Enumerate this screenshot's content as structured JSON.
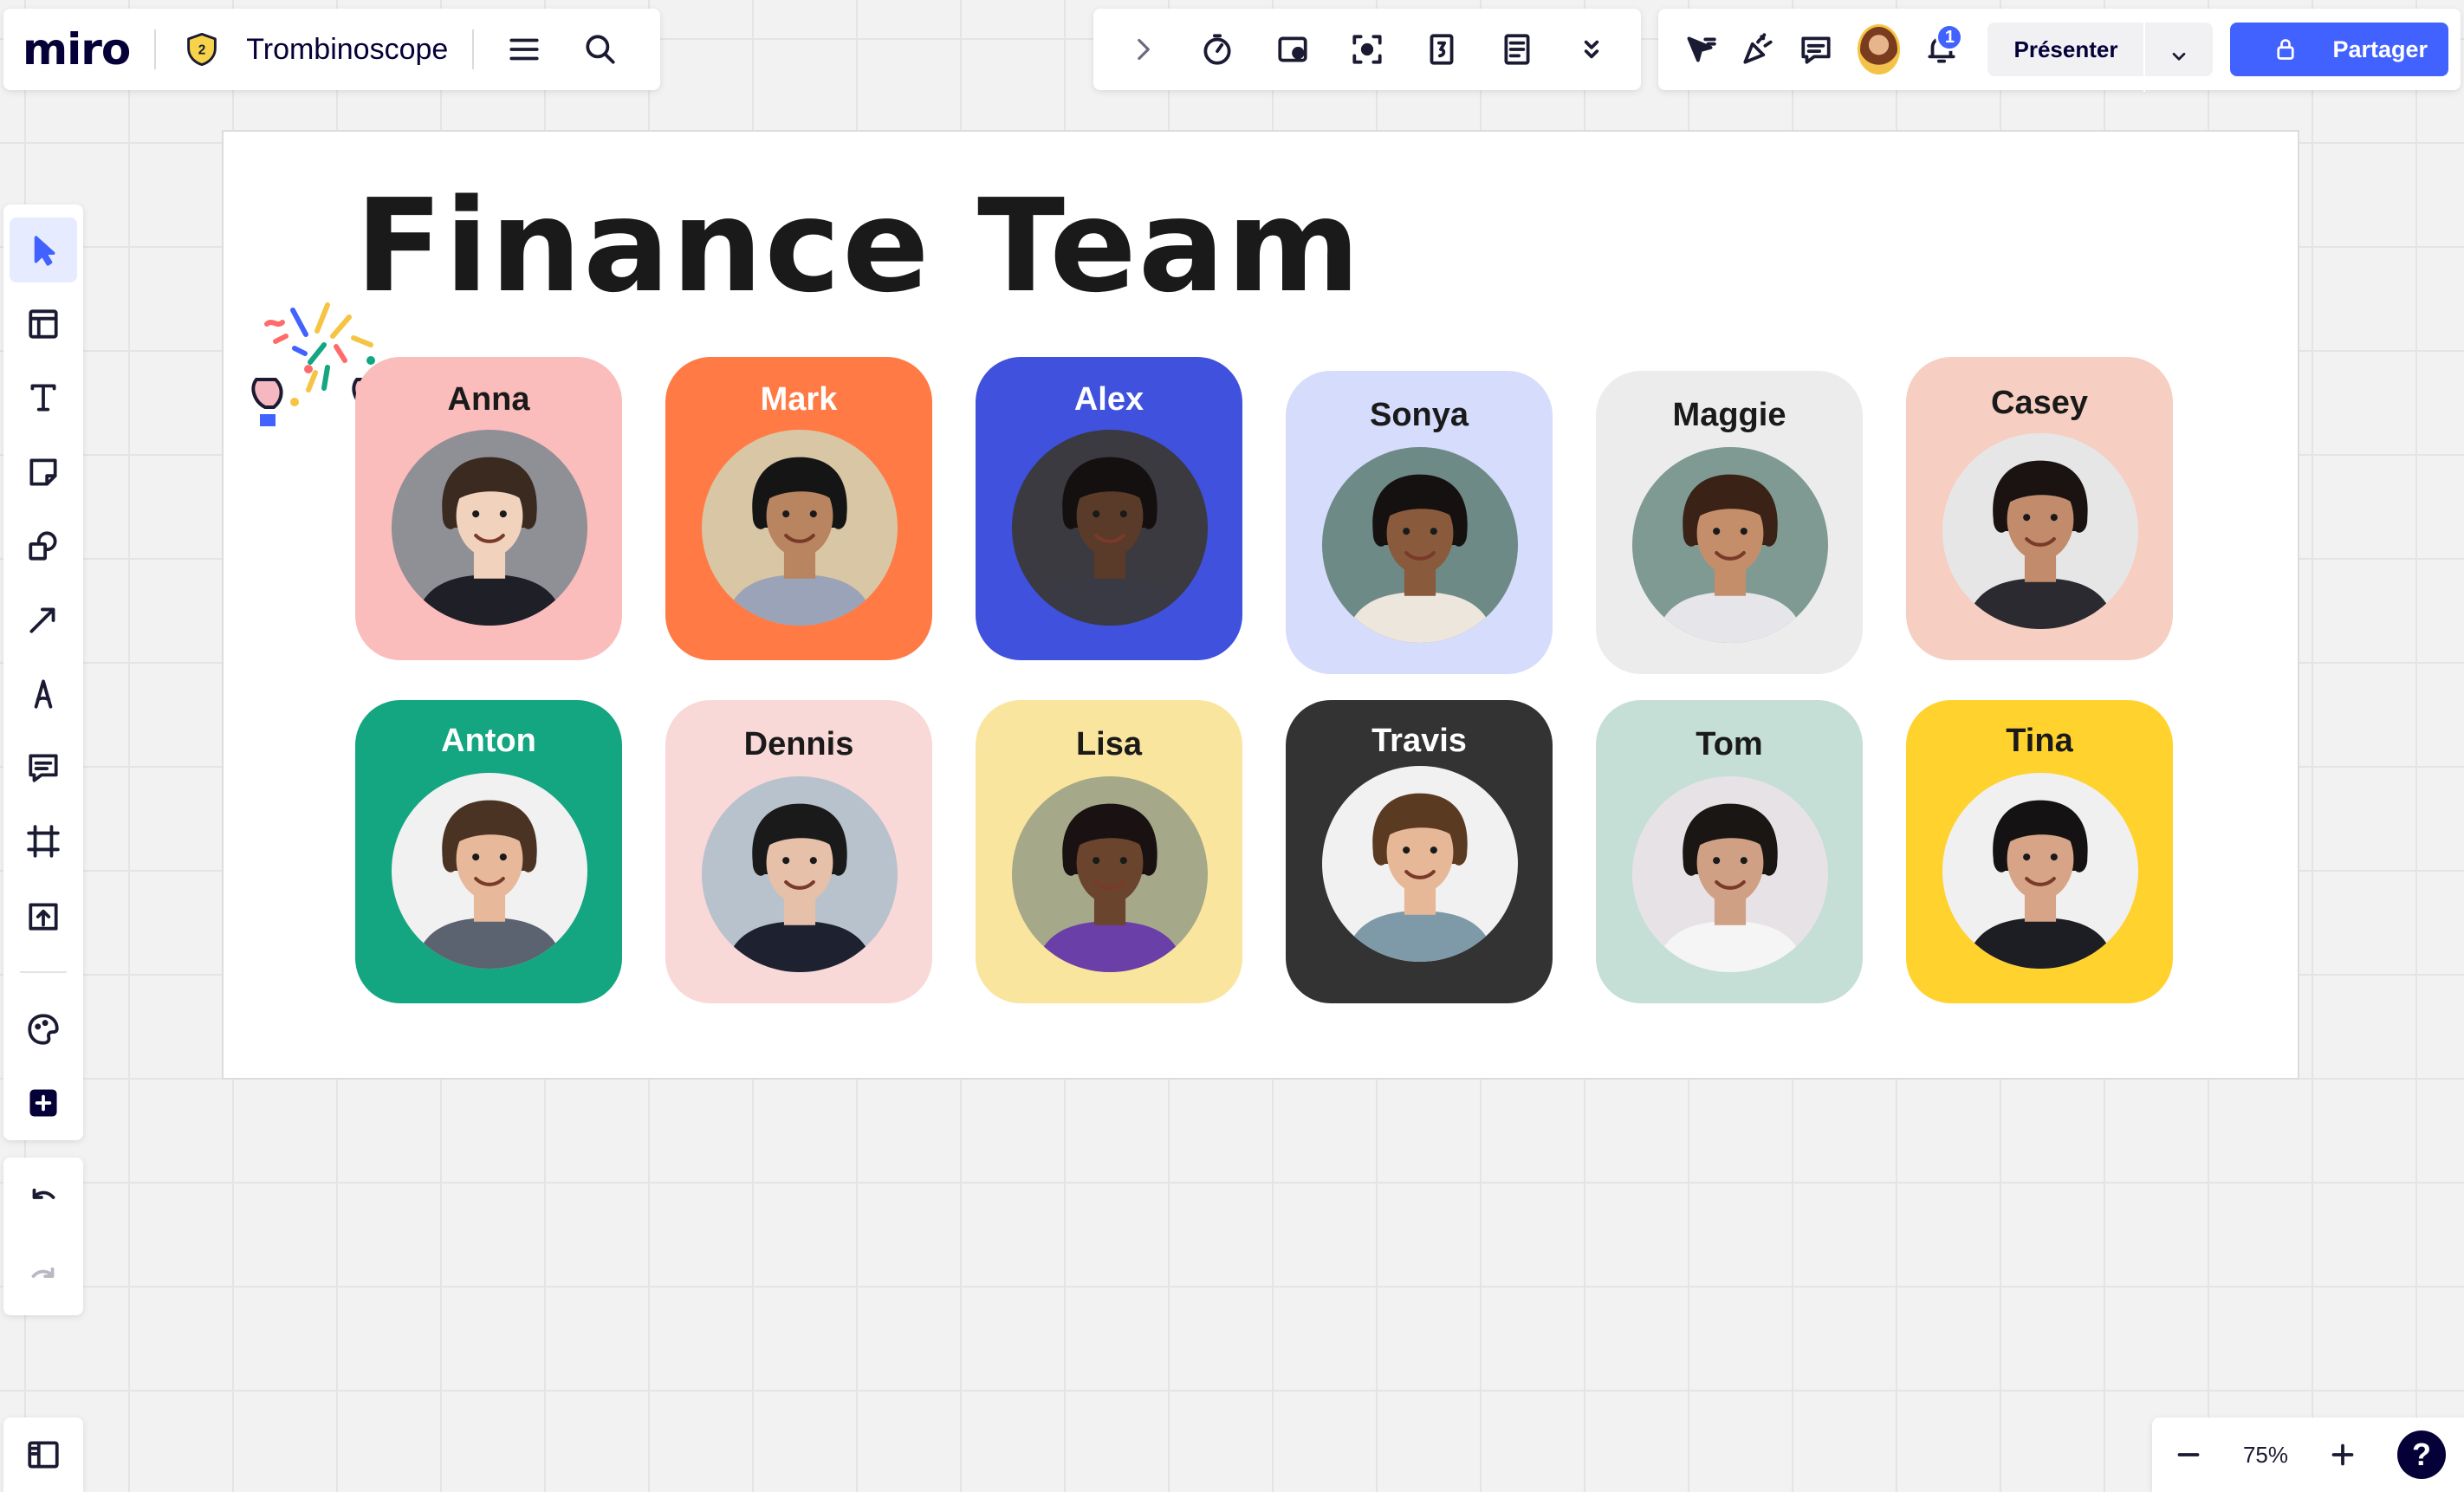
{
  "app": {
    "logo": "miro",
    "board_title": "Trombinoscope",
    "plan_badge": "2"
  },
  "top_middle_tools": [
    {
      "name": "expand-icon"
    },
    {
      "name": "timer-icon"
    },
    {
      "name": "card-icon"
    },
    {
      "name": "focus-icon"
    },
    {
      "name": "voting-icon"
    },
    {
      "name": "notes-icon"
    },
    {
      "name": "more-icon"
    }
  ],
  "top_right": {
    "notifications_count": "1",
    "present_label": "Présenter",
    "share_label": "Partager"
  },
  "left_tools": [
    {
      "name": "select-tool"
    },
    {
      "name": "templates-tool"
    },
    {
      "name": "text-tool"
    },
    {
      "name": "sticky-note-tool"
    },
    {
      "name": "shapes-tool"
    },
    {
      "name": "arrow-tool"
    },
    {
      "name": "pen-tool"
    },
    {
      "name": "comment-tool"
    },
    {
      "name": "frame-tool"
    },
    {
      "name": "upload-tool"
    }
  ],
  "zoom": {
    "level": "75%"
  },
  "help_label": "?",
  "frame": {
    "title": "Finance Team",
    "cards": [
      {
        "name": "Anna",
        "bg": "#fbbcbc",
        "text": "#1a1a1a",
        "skin": "#f1d2bd",
        "hair": "#3a2a20",
        "cloth": "#1f1f28",
        "photo_bg": "#8f8f96"
      },
      {
        "name": "Mark",
        "bg": "#ff7a45",
        "text": "#ffffff",
        "skin": "#b98560",
        "hair": "#151515",
        "cloth": "#9aa3b8",
        "photo_bg": "#d9c6a4"
      },
      {
        "name": "Alex",
        "bg": "#3f51dd",
        "text": "#ffffff",
        "skin": "#5a3a28",
        "hair": "#151010",
        "cloth": "#3a3a44",
        "photo_bg": "#3a3a40"
      },
      {
        "name": "Sonya",
        "bg": "#d6dcfb",
        "text": "#1a1a1a",
        "skin": "#8a5a3c",
        "hair": "#161111",
        "cloth": "#ece6dc",
        "photo_bg": "#6e8a86"
      },
      {
        "name": "Maggie",
        "bg": "#ececec",
        "text": "#1a1a1a",
        "skin": "#c48e6a",
        "hair": "#3a2217",
        "cloth": "#e6e6ea",
        "photo_bg": "#7f9a92"
      },
      {
        "name": "Casey",
        "bg": "#f6cfc2",
        "text": "#1a1a1a",
        "skin": "#c18b6c",
        "hair": "#1a1312",
        "cloth": "#2a2a30",
        "photo_bg": "#e6e6e6"
      },
      {
        "name": "Anton",
        "bg": "#13a681",
        "text": "#ffffff",
        "skin": "#e7b99a",
        "hair": "#4a3322",
        "cloth": "#5b6270",
        "photo_bg": "#f1f1f1"
      },
      {
        "name": "Dennis",
        "bg": "#f9d8d8",
        "text": "#1a1a1a",
        "skin": "#e6c0a8",
        "hair": "#1a1a1a",
        "cloth": "#1e2230",
        "photo_bg": "#b8c2cc"
      },
      {
        "name": "Lisa",
        "bg": "#fae59e",
        "text": "#1a1a1a",
        "skin": "#6a442c",
        "hair": "#1a1212",
        "cloth": "#6b3fa8",
        "photo_bg": "#a6a88a"
      },
      {
        "name": "Travis",
        "bg": "#333333",
        "text": "#ffffff",
        "skin": "#e6b897",
        "hair": "#5b3a22",
        "cloth": "#7e9aa8",
        "photo_bg": "#f1f1f1"
      },
      {
        "name": "Tom",
        "bg": "#c5ded6",
        "text": "#1a1a1a",
        "skin": "#cfa084",
        "hair": "#1a1614",
        "cloth": "#f5f5f5",
        "photo_bg": "#e7e2e6"
      },
      {
        "name": "Tina",
        "bg": "#ffd22e",
        "text": "#1a1a1a",
        "skin": "#d8a487",
        "hair": "#141212",
        "cloth": "#1d1d24",
        "photo_bg": "#f0f0f0"
      }
    ]
  }
}
